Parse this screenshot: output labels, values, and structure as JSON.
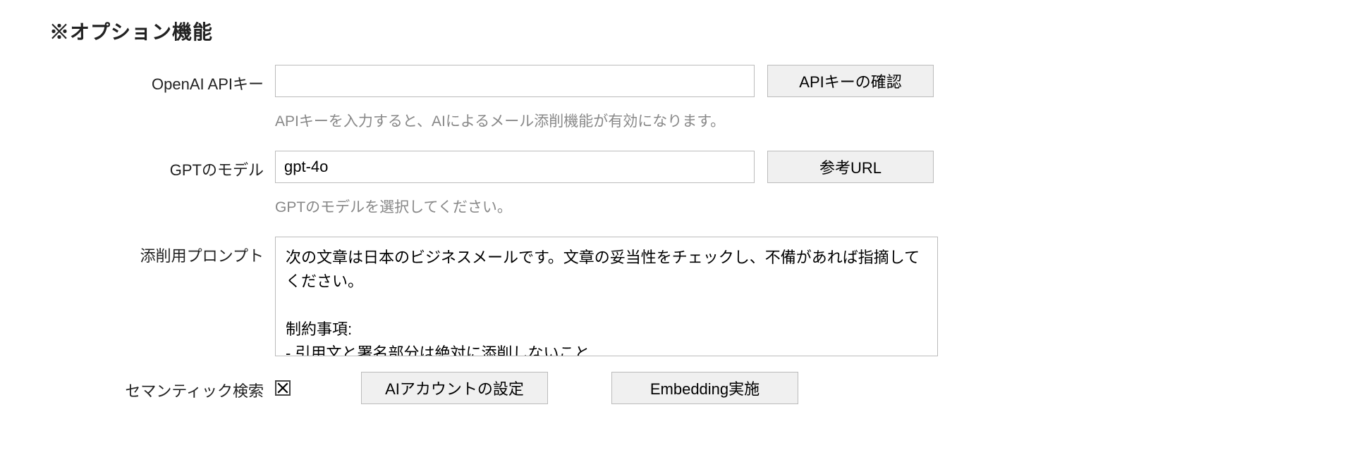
{
  "section": {
    "title": "※オプション機能"
  },
  "apiKey": {
    "label": "OpenAI APIキー",
    "value": "",
    "button": "APIキーの確認",
    "help": "APIキーを入力すると、AIによるメール添削機能が有効になります。"
  },
  "gptModel": {
    "label": "GPTのモデル",
    "value": "gpt-4o",
    "button": "参考URL",
    "help": "GPTのモデルを選択してください。"
  },
  "prompt": {
    "label": "添削用プロンプト",
    "value": "次の文章は日本のビジネスメールです。文章の妥当性をチェックし、不備があれば指摘してください。\n\n制約事項:\n- 引用文と署名部分は絶対に添削しないこと\n- 誤字脱字は必ず指摘すること\n- 指摘した箇所がわかるように、修正前と修正後の文章を載せること"
  },
  "semantic": {
    "label": "セマンティック検索",
    "checked": true,
    "button1": "AIアカウントの設定",
    "button2": "Embedding実施"
  }
}
